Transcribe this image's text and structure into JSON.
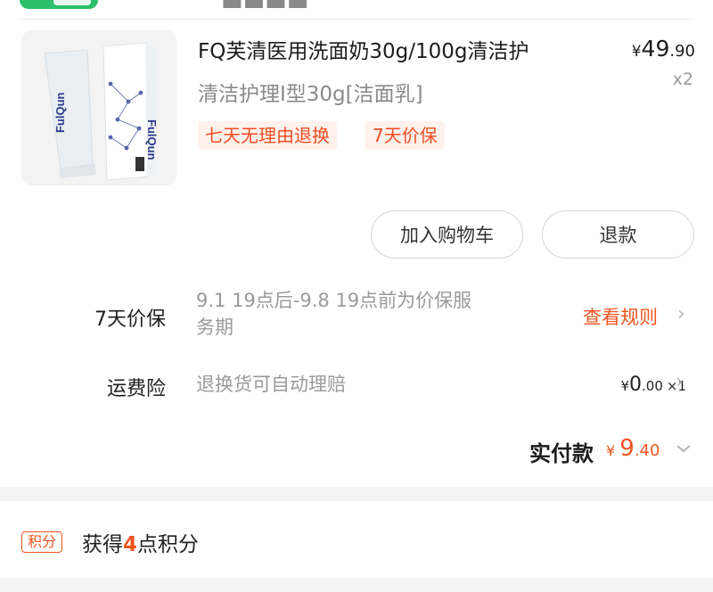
{
  "product": {
    "title": "FQ芙清医用洗面奶30g/100g清洁护",
    "sku": "清洁护理Ⅰ型30g[洁面乳]",
    "price": {
      "symbol": "¥",
      "int": "49",
      "dec": ".90"
    },
    "quantity": "x2",
    "tags": [
      "七天无理由退换",
      "7天价保"
    ]
  },
  "actions": {
    "add_to_cart": "加入购物车",
    "refund": "退款"
  },
  "price_protection": {
    "label": "7天价保",
    "period": "9.1 19点后-9.8 19点前为价保服务期",
    "link": "查看规则"
  },
  "shipping_insurance": {
    "label": "运费险",
    "desc": "退换货可自动理赔",
    "price": {
      "symbol": "¥",
      "int": "0",
      "dec": ".00"
    },
    "count": "×1"
  },
  "payment": {
    "label": "实付款",
    "symbol": "¥",
    "int": "9",
    "dec": ".40"
  },
  "points": {
    "badge": "积分",
    "prefix": "获得",
    "number": "4",
    "suffix": "点积分"
  },
  "colors": {
    "accent": "#f0541f",
    "tag_bg": "#fff1ec",
    "brand_green": "#2bbf6a"
  },
  "icons": [
    "chevron-right-icon",
    "chevron-down-icon"
  ]
}
